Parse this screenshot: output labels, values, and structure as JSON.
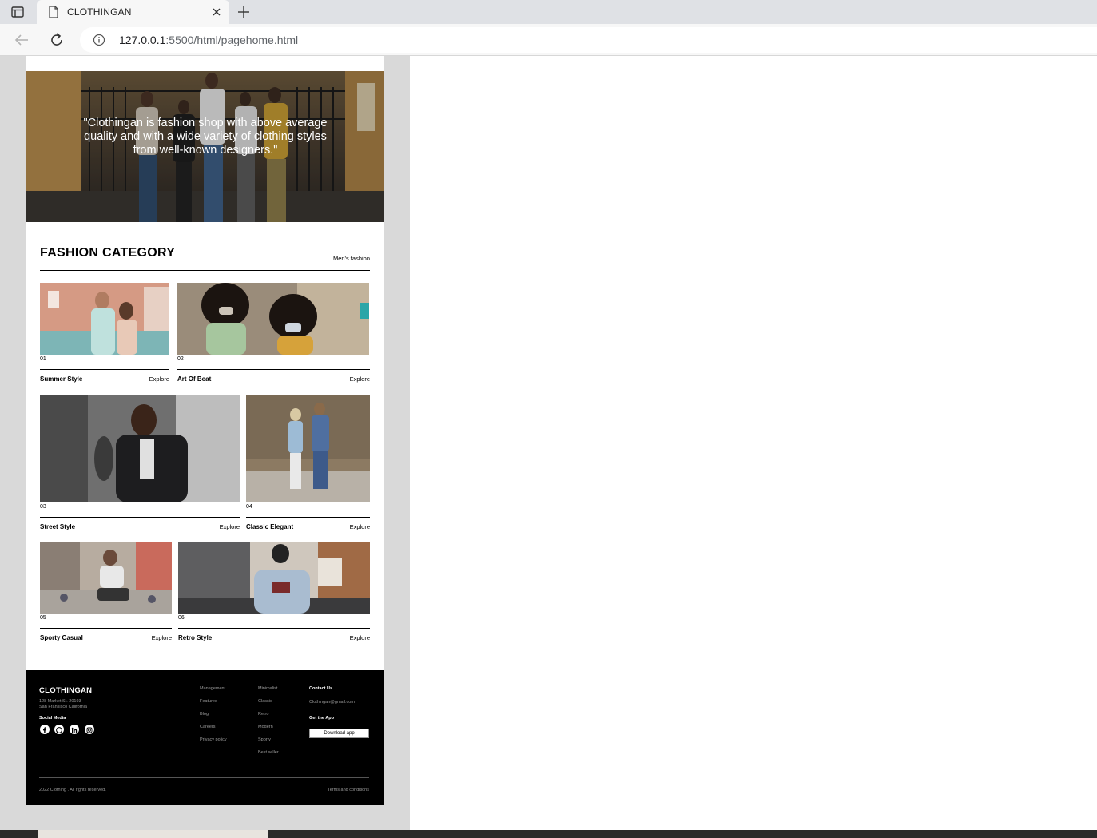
{
  "browser": {
    "tab_title": "CLOTHINGAN",
    "url_host": "127.0.0.1",
    "url_rest": ":5500/html/pagehome.html"
  },
  "hero": {
    "quote": "\"Clothingan is fashion shop with above average quality and with a wide variety of clothing styles from well-known designers.\""
  },
  "category": {
    "title": "FASHION CATEGORY",
    "link": "Men's fashion",
    "items": [
      {
        "num": "01",
        "name": "Summer Style",
        "action": "Explore"
      },
      {
        "num": "02",
        "name": "Art Of Beat",
        "action": "Explore"
      },
      {
        "num": "03",
        "name": "Street Style",
        "action": "Explore"
      },
      {
        "num": "04",
        "name": "Classic Elegant",
        "action": "Explore"
      },
      {
        "num": "05",
        "name": "Sporty Casual",
        "action": "Explore"
      },
      {
        "num": "06",
        "name": "Retro Style",
        "action": "Explore"
      }
    ]
  },
  "footer": {
    "brand": "CLOTHINGAN",
    "address_line1": "128 Market St. 20193",
    "address_line2": "San Fransisco California",
    "social_title": "Social Media",
    "social_icons": [
      "facebook-icon",
      "whatsapp-icon",
      "linkedin-icon",
      "instagram-icon"
    ],
    "col1": [
      "Management",
      "Features",
      "Blog",
      "Careers",
      "Privacy policy"
    ],
    "col2": [
      "Minimalist",
      "Classic",
      "Retro",
      "Modern",
      "Sporty",
      "Best seller"
    ],
    "contact_title": "Contact Us",
    "email": "Clothingan@gmail.com",
    "app_title": "Get the App",
    "download_label": "Download app",
    "copyright": "2022 Clothing . All rights reserved.",
    "terms": "Terms and conditions"
  }
}
